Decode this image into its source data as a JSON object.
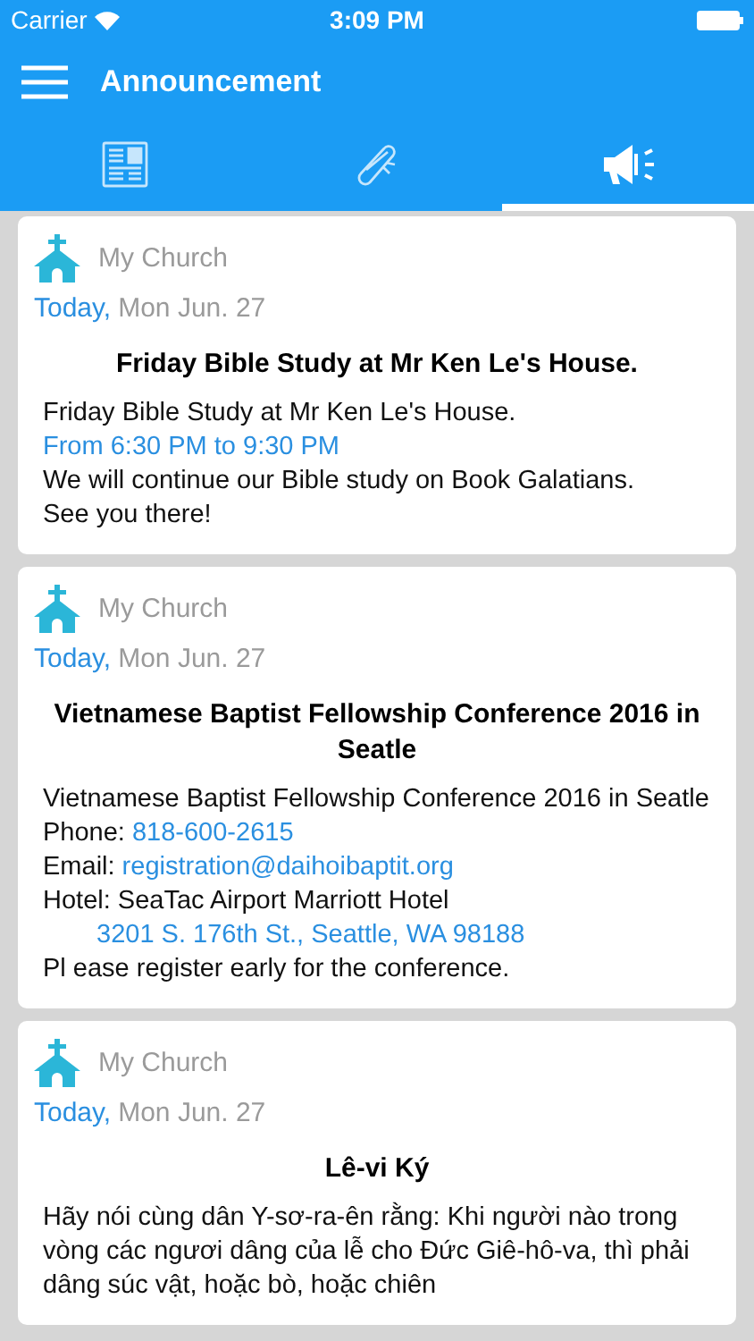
{
  "status_bar": {
    "carrier": "Carrier",
    "time": "3:09 PM"
  },
  "header": {
    "title": "Announcement"
  },
  "tabs": [
    {
      "kind": "news",
      "selected": false
    },
    {
      "kind": "scroll",
      "selected": false
    },
    {
      "kind": "megaphone",
      "selected": true
    }
  ],
  "posts": [
    {
      "church": "My Church",
      "day": "Today,",
      "date": "Mon Jun. 27",
      "title": "Friday Bible Study at Mr Ken Le's House.",
      "lines": [
        {
          "kind": "line",
          "segments": [
            {
              "text": "Friday Bible Study at Mr Ken Le's House.",
              "link": false
            }
          ]
        },
        {
          "kind": "line",
          "segments": [
            {
              "text": "From 6:30 PM to 9:30 PM",
              "link": true
            }
          ]
        },
        {
          "kind": "line",
          "segments": [
            {
              "text": "We will continue our Bible study on Book Galatians.",
              "link": false
            }
          ]
        },
        {
          "kind": "line",
          "segments": [
            {
              "text": "See you there!",
              "link": false
            }
          ]
        }
      ]
    },
    {
      "church": "My Church",
      "day": "Today,",
      "date": "Mon Jun. 27",
      "title": "Vietnamese Baptist Fellowship Conference 2016 in Seatle",
      "lines": [
        {
          "kind": "line",
          "segments": [
            {
              "text": "Vietnamese Baptist Fellowship Conference 2016 in Seatle",
              "link": false
            }
          ]
        },
        {
          "kind": "line",
          "segments": [
            {
              "text": "Phone:",
              "link": false
            },
            {
              "text": "818-600-2615",
              "link": true
            }
          ]
        },
        {
          "kind": "line",
          "segments": [
            {
              "text": "Email:",
              "link": false
            },
            {
              "text": "registration@daihoibaptit.org",
              "link": true
            }
          ]
        },
        {
          "kind": "line",
          "segments": [
            {
              "text": "Hotel: SeaTac Airport Marriott Hotel",
              "link": false
            }
          ]
        },
        {
          "kind": "continuation",
          "segments": [
            {
              "text": "3201 S. 176th St., Seattle, WA 98188",
              "link": true
            }
          ]
        },
        {
          "kind": "line",
          "segments": [
            {
              "text": "Pl  ease register early for the conference.",
              "link": false
            }
          ]
        }
      ]
    },
    {
      "church": "My Church",
      "day": "Today,",
      "date": "Mon Jun. 27",
      "title": "Lê-vi Ký",
      "lines": [
        {
          "kind": "line",
          "segments": [
            {
              "text": "Hãy nói cùng dân Y-sơ-ra-ên rằng: Khi người nào trong vòng các ngươi dâng của lễ cho Đức Giê-hô-va, thì phải dâng súc vật, hoặc bò, hoặc chiên",
              "link": false
            }
          ]
        }
      ]
    }
  ]
}
